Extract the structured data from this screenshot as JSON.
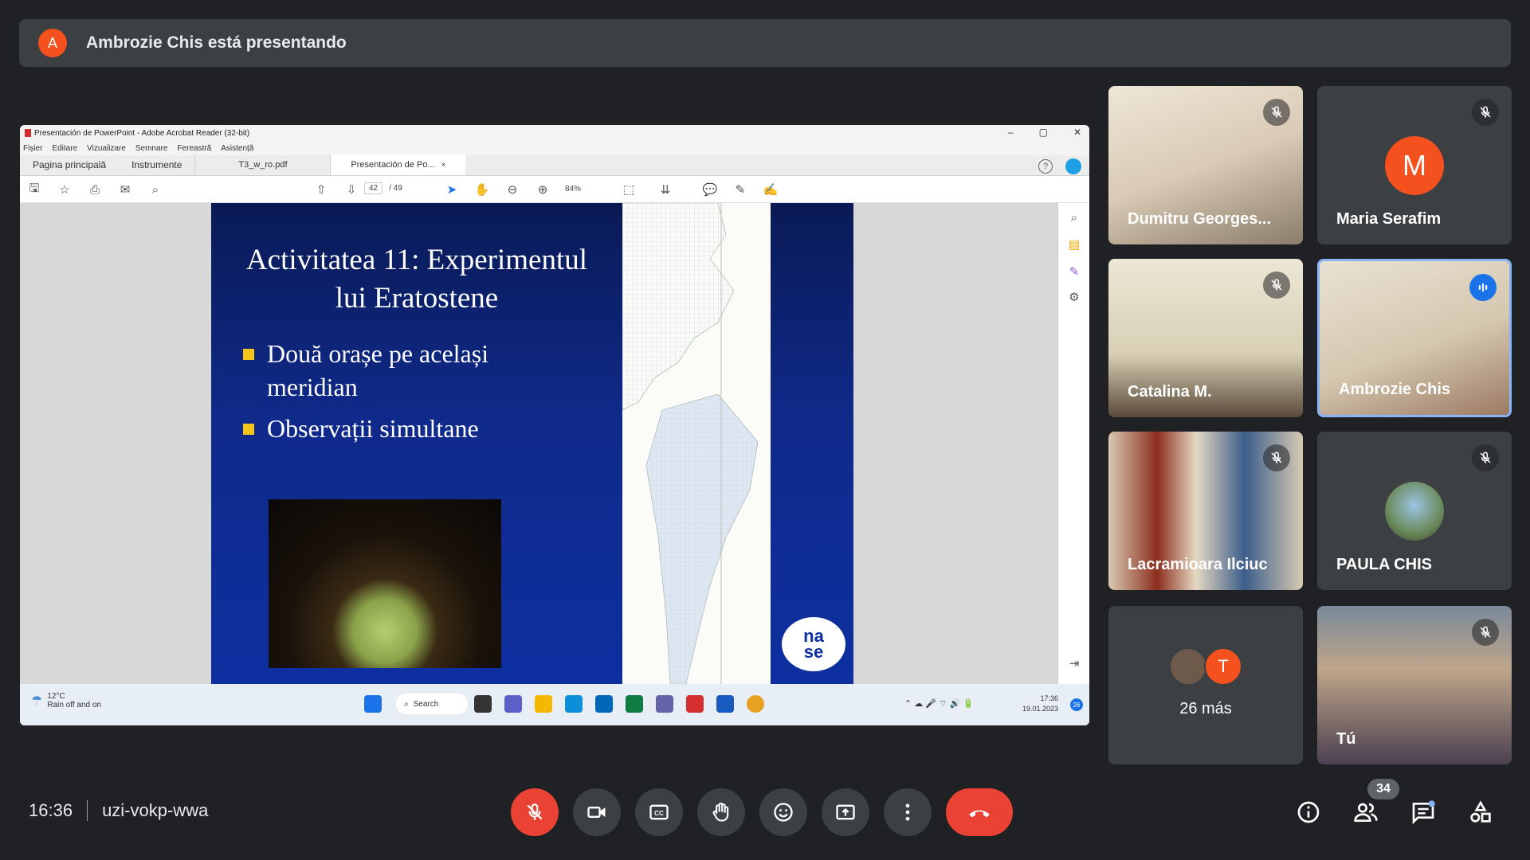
{
  "presenter_banner": {
    "avatar_letter": "A",
    "text": "Ambrozie Chis está presentando",
    "avatar_color": "#f4511e"
  },
  "shared_screen": {
    "window_title": "Presentación de PowerPoint - Adobe Acrobat Reader (32-bit)",
    "menu": [
      "Fișier",
      "Editare",
      "Vizualizare",
      "Semnare",
      "Fereastră",
      "Asistență"
    ],
    "tabs": {
      "home": "Pagina principală",
      "tools": "Instrumente",
      "doc1": "T3_w_ro.pdf",
      "doc2": "Presentación de Po...",
      "close": "×"
    },
    "page_current": "42",
    "page_total": "/ 49",
    "zoom": "84%",
    "slide": {
      "title_line1": "Activitatea 11: Experimentul",
      "title_line2": "lui Eratostene",
      "bullet1_line1": "Două orașe pe același",
      "bullet1_line2": "meridian",
      "bullet2": "Observații simultane",
      "logo_line1": "na",
      "logo_line2": "se"
    },
    "taskbar": {
      "temp": "12°C",
      "weather": "Rain off and on",
      "search": "Search",
      "time": "17:36",
      "date": "19.01.2023",
      "notif": "26"
    }
  },
  "participants": [
    {
      "name": "Dumitru Georges...",
      "muted": true
    },
    {
      "name": "Maria Serafim",
      "avatar_letter": "M",
      "avatar_color": "#f4511e",
      "muted": true
    },
    {
      "name": "Catalina M.",
      "muted": true
    },
    {
      "name": "Ambrozie Chis",
      "speaking": true
    },
    {
      "name": "Lacramioara Ilciuc",
      "muted": true
    },
    {
      "name": "PAULA CHIS",
      "muted": true
    },
    {
      "name": "26 más",
      "avatar_letter": "T",
      "avatar_color": "#f4511e"
    },
    {
      "name": "Tú",
      "muted": true
    }
  ],
  "bottom_bar": {
    "time": "16:36",
    "meeting_code": "uzi-vokp-wwa",
    "participant_count": "34"
  }
}
